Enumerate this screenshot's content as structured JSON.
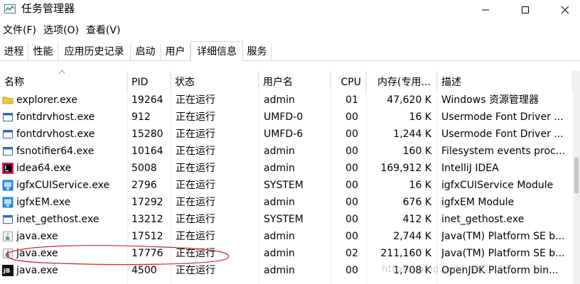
{
  "window": {
    "title": "任务管理器",
    "buttons": {
      "minimize": "—",
      "maximize": "☐",
      "close": "✕"
    }
  },
  "menu": [
    "文件(F)",
    "选项(O)",
    "查看(V)"
  ],
  "tabs": [
    "进程",
    "性能",
    "应用历史记录",
    "启动",
    "用户",
    "详细信息",
    "服务"
  ],
  "active_tab": "详细信息",
  "columns": {
    "name": "名称",
    "pid": "PID",
    "status": "状态",
    "user": "用户名",
    "cpu": "CPU",
    "memory": "内存(专用...",
    "description": "描述"
  },
  "rows": [
    {
      "icon": "folder-icon",
      "name": "explorer.exe",
      "pid": "19264",
      "status": "正在运行",
      "user": "admin",
      "cpu": "01",
      "memory": "47,620 K",
      "description": "Windows 资源管理器"
    },
    {
      "icon": "window-icon",
      "name": "fontdrvhost.exe",
      "pid": "912",
      "status": "正在运行",
      "user": "UMFD-0",
      "cpu": "00",
      "memory": "16 K",
      "description": "Usermode Font Driver ..."
    },
    {
      "icon": "window-icon",
      "name": "fontdrvhost.exe",
      "pid": "15280",
      "status": "正在运行",
      "user": "UMFD-6",
      "cpu": "00",
      "memory": "1,244 K",
      "description": "Usermode Font Driver ..."
    },
    {
      "icon": "window-icon",
      "name": "fsnotifier64.exe",
      "pid": "10164",
      "status": "正在运行",
      "user": "admin",
      "cpu": "00",
      "memory": "160 K",
      "description": "Filesystem events proc..."
    },
    {
      "icon": "intellij-icon",
      "name": "idea64.exe",
      "pid": "5008",
      "status": "正在运行",
      "user": "admin",
      "cpu": "00",
      "memory": "169,912 K",
      "description": "IntelliJ IDEA"
    },
    {
      "icon": "monitor-icon",
      "name": "igfxCUIService.exe",
      "pid": "2796",
      "status": "正在运行",
      "user": "SYSTEM",
      "cpu": "00",
      "memory": "16 K",
      "description": "igfxCUIService Module"
    },
    {
      "icon": "monitor-icon",
      "name": "igfxEM.exe",
      "pid": "17292",
      "status": "正在运行",
      "user": "admin",
      "cpu": "00",
      "memory": "676 K",
      "description": "igfxEM Module"
    },
    {
      "icon": "window-icon",
      "name": "inet_gethost.exe",
      "pid": "13212",
      "status": "正在运行",
      "user": "SYSTEM",
      "cpu": "00",
      "memory": "412 K",
      "description": "inet_gethost.exe"
    },
    {
      "icon": "java-icon",
      "name": "java.exe",
      "pid": "17512",
      "status": "正在运行",
      "user": "admin",
      "cpu": "00",
      "memory": "2,744 K",
      "description": "Java(TM) Platform SE b..."
    },
    {
      "icon": "java-icon",
      "name": "java.exe",
      "pid": "17776",
      "status": "正在运行",
      "user": "admin",
      "cpu": "02",
      "memory": "211,160 K",
      "description": "Java(TM) Platform SE b..."
    },
    {
      "icon": "jdk-icon",
      "name": "java.exe",
      "pid": "4500",
      "status": "正在运行",
      "user": "admin",
      "cpu": "00",
      "memory": "1,708 K",
      "description": "OpenJDK Platform bin..."
    }
  ],
  "watermark": "https://blog.csdn.net/...03"
}
